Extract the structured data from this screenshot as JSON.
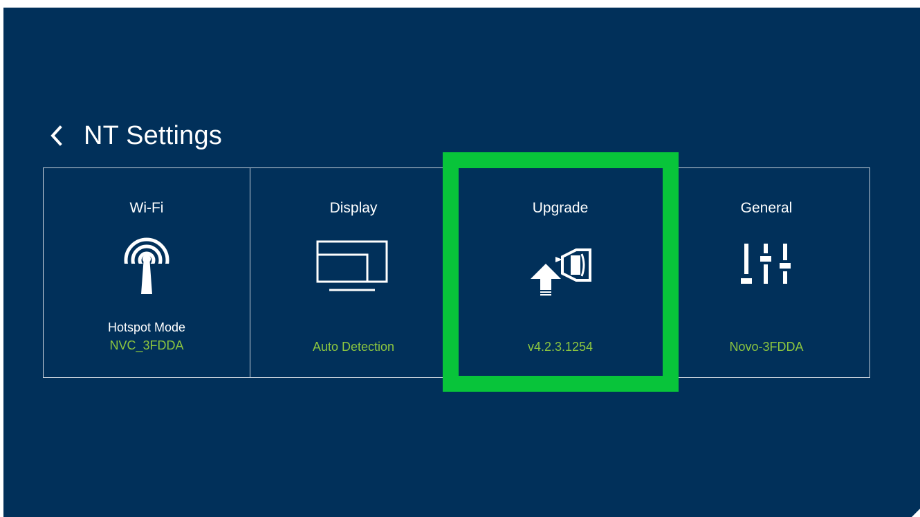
{
  "header": {
    "back_icon": "chevron-left-icon",
    "title": "NT Settings"
  },
  "tiles": [
    {
      "title": "Wi-Fi",
      "icon": "wifi-hotspot-icon",
      "subtitle": "Hotspot Mode",
      "value": "NVC_3FDDA"
    },
    {
      "title": "Display",
      "icon": "display-icon",
      "subtitle": "",
      "value": "Auto Detection"
    },
    {
      "title": "Upgrade",
      "icon": "upgrade-icon",
      "subtitle": "",
      "value": "v4.2.3.1254"
    },
    {
      "title": "General",
      "icon": "sliders-icon",
      "subtitle": "",
      "value": "Novo-3FDDA"
    }
  ],
  "selected_tile": "Upgrade",
  "colors": {
    "background": "#01305a",
    "accent_value": "#8dc63f",
    "focus_ring": "#08c43a",
    "divider": "#c9d2dc"
  }
}
